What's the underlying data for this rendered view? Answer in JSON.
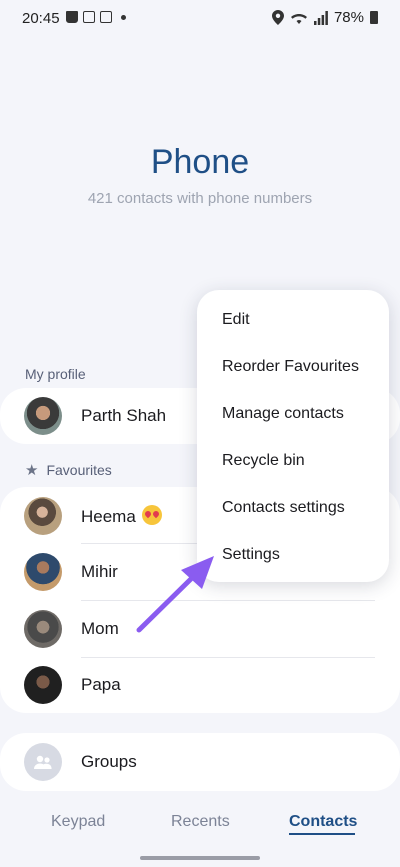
{
  "status_bar": {
    "time": "20:45",
    "battery": "78%",
    "icons": [
      "shopping-bag-icon",
      "calendar-icon",
      "calendar-icon",
      "notification-dot-icon",
      "location-icon",
      "wifi-icon",
      "signal-icon",
      "battery-icon"
    ]
  },
  "header": {
    "title": "Phone",
    "subtitle": "421 contacts with phone numbers"
  },
  "profile_section": {
    "label": "My profile",
    "name": "Parth Shah"
  },
  "favourites_section": {
    "label": "Favourites",
    "icon": "star-icon",
    "items": [
      {
        "name": "Heema",
        "emoji": "heart-eyes-emoji"
      },
      {
        "name": "Mihir"
      },
      {
        "name": "Mom"
      },
      {
        "name": "Papa"
      }
    ]
  },
  "groups": {
    "label": "Groups",
    "icon": "people-icon"
  },
  "menu": {
    "items": [
      "Edit",
      "Reorder Favourites",
      "Manage contacts",
      "Recycle bin",
      "Contacts settings",
      "Settings"
    ]
  },
  "bottom_nav": {
    "tabs": [
      "Keypad",
      "Recents",
      "Contacts"
    ],
    "active": "Contacts"
  },
  "colors": {
    "accent": "#1f4f86",
    "annotation_arrow": "#8a5cf0",
    "background": "#f4f5fa"
  }
}
